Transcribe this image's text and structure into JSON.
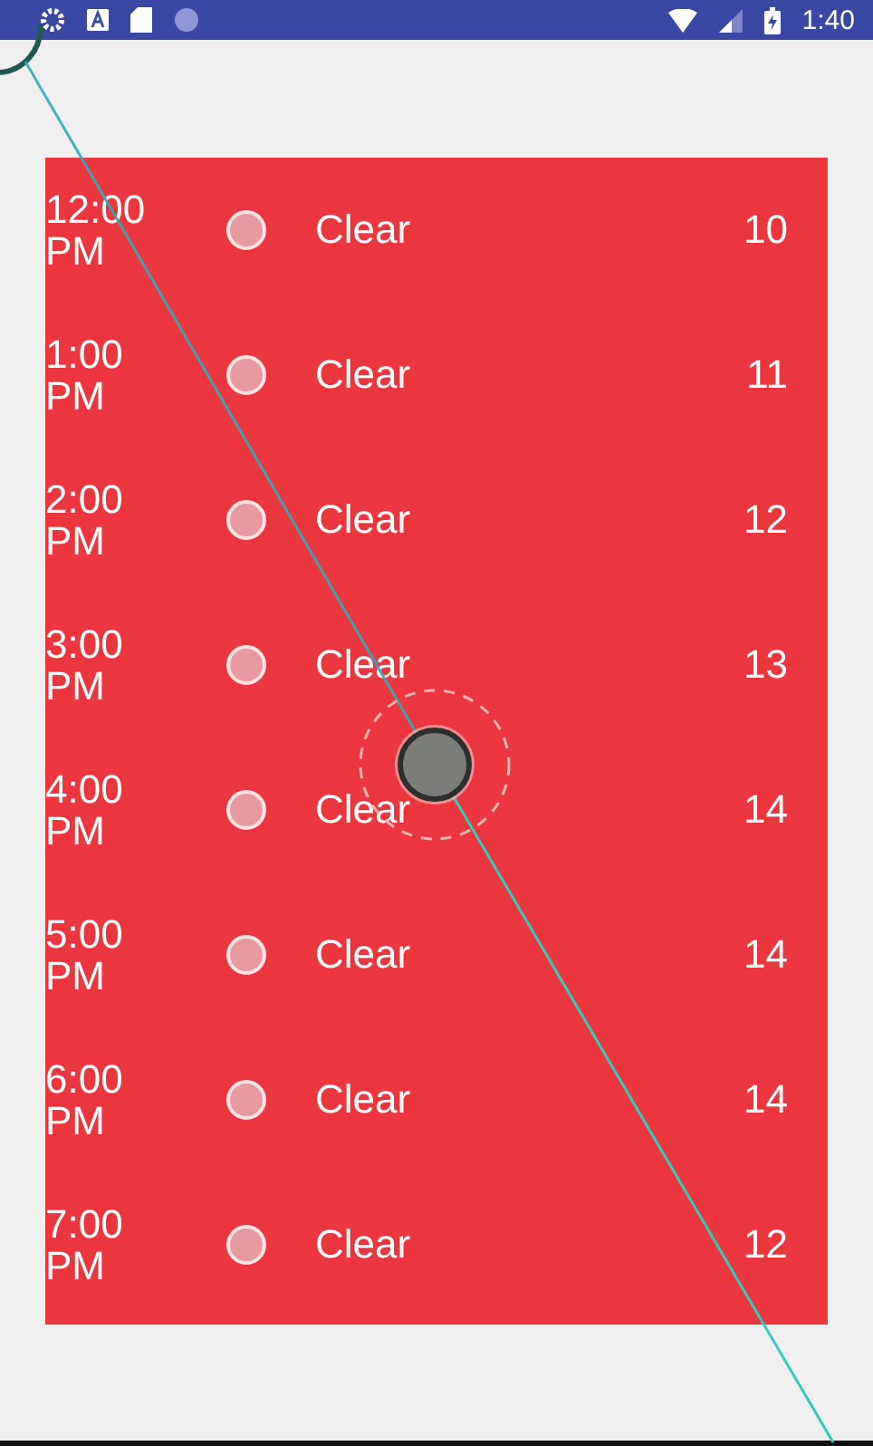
{
  "status_bar": {
    "time": "1:40"
  },
  "forecast": [
    {
      "time": "12:00 PM",
      "condition": "Clear",
      "value": "10"
    },
    {
      "time": "1:00 PM",
      "condition": "Clear",
      "value": "11"
    },
    {
      "time": "2:00 PM",
      "condition": "Clear",
      "value": "12"
    },
    {
      "time": "3:00 PM",
      "condition": "Clear",
      "value": "13"
    },
    {
      "time": "4:00 PM",
      "condition": "Clear",
      "value": "14"
    },
    {
      "time": "5:00 PM",
      "condition": "Clear",
      "value": "14"
    },
    {
      "time": "6:00 PM",
      "condition": "Clear",
      "value": "14"
    },
    {
      "time": "7:00 PM",
      "condition": "Clear",
      "value": "12"
    }
  ]
}
